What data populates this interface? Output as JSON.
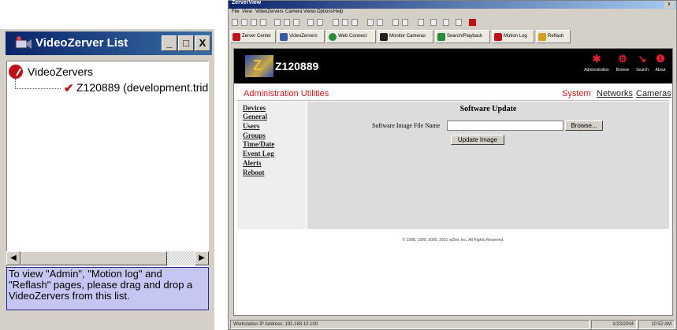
{
  "left_panel": {
    "title": "VideoZerver List",
    "controls": {
      "minimize": "_",
      "maximize": "□",
      "close": "X"
    },
    "tree": {
      "root": "VideoZervers",
      "children": [
        "Z120889 (development.trider"
      ]
    },
    "message": "To view \"Admin\", \"Motion log\" and \"Reflash\" pages, please drag and drop a VideoZervers from this list."
  },
  "main_window": {
    "title": "ZerverView",
    "close_glyph": "x",
    "menu": [
      "File",
      "View",
      "VideoZervers",
      "Camera Views",
      "Options",
      "Help"
    ],
    "tabs": [
      {
        "label": "Zerver Center",
        "icon": "zerver-center-icon",
        "color": "#c0101a"
      },
      {
        "label": "VideoZervers",
        "icon": "videozervers-icon",
        "color": "#3a5aa8"
      },
      {
        "label": "Web Connect",
        "icon": "globe-icon",
        "color": "#2a8a3a"
      },
      {
        "label": "Monitor Cameras",
        "icon": "monitor-icon",
        "color": "#222222"
      },
      {
        "label": "Search/Playback",
        "icon": "search-playback-icon",
        "color": "#2a8a3a"
      },
      {
        "label": "Motion Log",
        "icon": "motion-log-icon",
        "color": "#c0101a"
      },
      {
        "label": "Reflash",
        "icon": "reflash-icon",
        "color": "#d4a020"
      }
    ],
    "header": {
      "zerver_id": "Z120889",
      "nav": [
        {
          "label": "Administration",
          "icon": "administration-icon"
        },
        {
          "label": "Browse",
          "icon": "browse-icon"
        },
        {
          "label": "Search",
          "icon": "search-icon"
        },
        {
          "label": "About",
          "icon": "about-icon"
        }
      ]
    },
    "admin": {
      "title": "Administration Utilities",
      "links": [
        "System",
        "Networks",
        "Cameras"
      ],
      "active_link": "System"
    },
    "side_menu": [
      "Devices",
      "General",
      "Users",
      "Groups",
      "Time/Date",
      "Event Log",
      "Alerts",
      "Reboot"
    ],
    "software_update": {
      "heading": "Software Update",
      "file_label": "Software Image File Name",
      "file_value": "",
      "browse_label": "Browse...",
      "update_label": "Update Image"
    },
    "copyright": "© 1998, 1999, 2000, 2001 viZtre, Inc. All Rights Reserved.",
    "status": {
      "workstation": "Workstation IP Address: 192.168.10.100",
      "date": "1/23/2004",
      "time": "10:52 AM"
    }
  },
  "colors": {
    "titlebar": "#0a246a",
    "accent_red": "#cc1a1a",
    "message_bg": "#c6c6f2",
    "header_bg": "#000000"
  }
}
